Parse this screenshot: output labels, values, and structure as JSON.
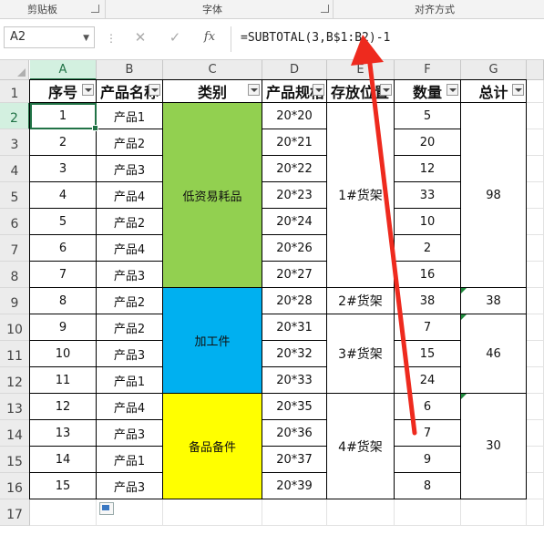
{
  "ribbon": {
    "groups": [
      "剪贴板",
      "字体",
      "对齐方式"
    ]
  },
  "formula_bar": {
    "name_box": "A2",
    "cancel_icon": "✕",
    "enter_icon": "✓",
    "fx_label": "fx",
    "formula": "=SUBTOTAL(3,B$1:B2)-1"
  },
  "columns": [
    "A",
    "B",
    "C",
    "D",
    "E",
    "F",
    "G"
  ],
  "rows": [
    "1",
    "2",
    "3",
    "4",
    "5",
    "6",
    "7",
    "8",
    "9",
    "10",
    "11",
    "12",
    "13",
    "14",
    "15",
    "16",
    "17"
  ],
  "headers": [
    "序号",
    "产品名称",
    "类别",
    "产品规格",
    "存放位置",
    "数量",
    "总计"
  ],
  "data": {
    "seq": [
      "1",
      "2",
      "3",
      "4",
      "5",
      "6",
      "7",
      "8",
      "9",
      "10",
      "11",
      "12",
      "13",
      "14",
      "15"
    ],
    "product": [
      "产品1",
      "产品2",
      "产品3",
      "产品4",
      "产品2",
      "产品4",
      "产品3",
      "产品2",
      "产品2",
      "产品3",
      "产品1",
      "产品4",
      "产品3",
      "产品1",
      "产品3"
    ],
    "spec": [
      "20*20",
      "20*21",
      "20*22",
      "20*23",
      "20*24",
      "20*26",
      "20*27",
      "20*28",
      "20*31",
      "20*32",
      "20*33",
      "20*35",
      "20*36",
      "20*37",
      "20*39"
    ],
    "qty": [
      "5",
      "20",
      "12",
      "33",
      "10",
      "2",
      "16",
      "38",
      "7",
      "15",
      "24",
      "6",
      "7",
      "9",
      "8"
    ]
  },
  "categories": [
    {
      "label": "低资易耗品",
      "color": "#92d050"
    },
    {
      "label": "加工件",
      "color": "#00b0f0"
    },
    {
      "label": "备品备件",
      "color": "#ffff00"
    }
  ],
  "locations": [
    "1#货架",
    "2#货架",
    "3#货架",
    "4#货架"
  ],
  "totals": [
    "98",
    "38",
    "46",
    "30"
  ],
  "accent_color": "#217346",
  "arrow_color": "#ee2a1e"
}
